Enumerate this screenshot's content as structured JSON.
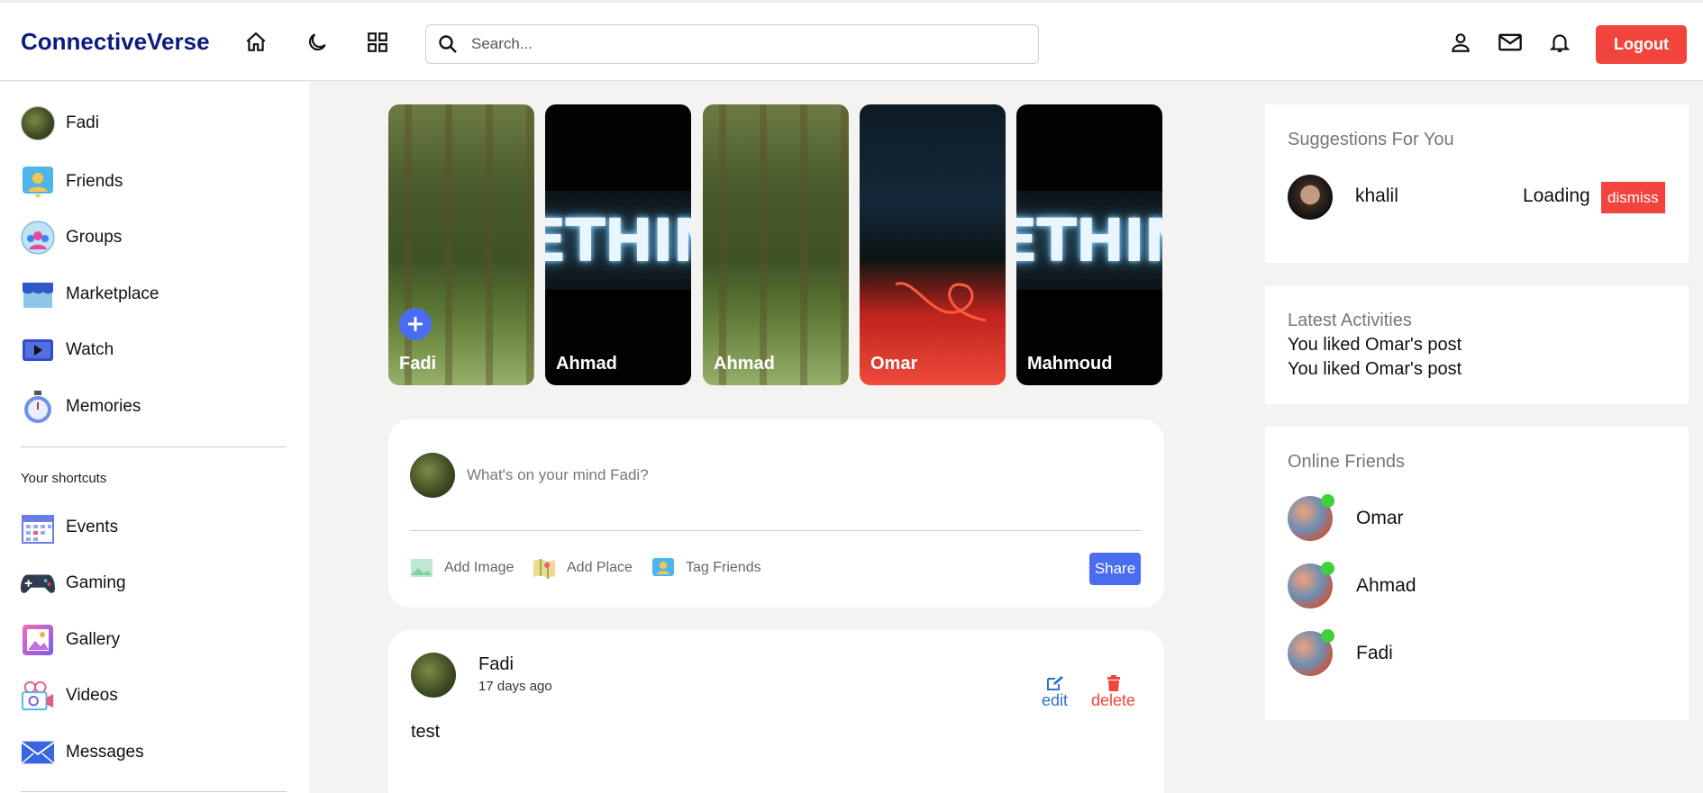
{
  "header": {
    "brand": "ConnectiveVerse",
    "search_placeholder": "Search...",
    "logout_label": "Logout"
  },
  "sidebar": {
    "items": [
      {
        "label": "Fadi"
      },
      {
        "label": "Friends"
      },
      {
        "label": "Groups"
      },
      {
        "label": "Marketplace"
      },
      {
        "label": "Watch"
      },
      {
        "label": "Memories"
      }
    ],
    "shortcuts_title": "Your shortcuts",
    "shortcuts": [
      {
        "label": "Events"
      },
      {
        "label": "Gaming"
      },
      {
        "label": "Gallery"
      },
      {
        "label": "Videos"
      },
      {
        "label": "Messages"
      }
    ]
  },
  "stories": [
    {
      "name": "Fadi",
      "image": "forest"
    },
    {
      "name": "Ahmad",
      "image": "neon-sign"
    },
    {
      "name": "Ahmad",
      "image": "forest"
    },
    {
      "name": "Omar",
      "image": "night-light-painting"
    },
    {
      "name": "Mahmoud",
      "image": "neon-sign"
    }
  ],
  "neon_sign_text": "METHING",
  "composer": {
    "placeholder": "What's on your mind Fadi?",
    "actions": [
      "Add Image",
      "Add Place",
      "Tag Friends"
    ],
    "share_label": "Share"
  },
  "post": {
    "author": "Fadi",
    "time": "17 days ago",
    "text": "test",
    "edit_label": "edit",
    "delete_label": "delete"
  },
  "suggestions": {
    "title": "Suggestions For You",
    "name": "khalil",
    "status": "Loading",
    "dismiss_label": "dismiss"
  },
  "activities": {
    "title": "Latest Activities",
    "items": [
      "You liked Omar's post",
      "You liked Omar's post"
    ]
  },
  "online_friends": {
    "title": "Online Friends",
    "items": [
      "Omar",
      "Ahmad",
      "Fadi"
    ]
  },
  "colors": {
    "brand": "#0d1a7f",
    "accent": "#4a6cf0",
    "danger": "#f1443c",
    "online": "#3fd13a",
    "edit": "#2f6fd6"
  }
}
